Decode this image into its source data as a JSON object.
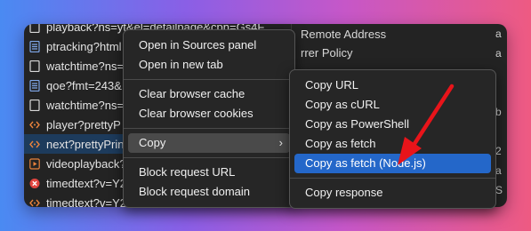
{
  "network_requests": [
    {
      "name": "playback?ns=yt&el=detailpage&cpn=Gs4F...",
      "icon": "document-icon",
      "type": "doc",
      "selected": false
    },
    {
      "name": "ptracking?html",
      "icon": "document-icon",
      "type": "doc-blue",
      "selected": false
    },
    {
      "name": "watchtime?ns=",
      "icon": "document-icon",
      "type": "doc",
      "selected": false
    },
    {
      "name": "qoe?fmt=243&",
      "icon": "document-icon",
      "type": "doc-blue",
      "selected": false
    },
    {
      "name": "watchtime?ns=",
      "icon": "document-icon",
      "type": "doc",
      "selected": false
    },
    {
      "name": "player?prettyP",
      "icon": "code-icon",
      "type": "code",
      "selected": false
    },
    {
      "name": "next?prettyPrin",
      "icon": "code-icon",
      "type": "code",
      "selected": true
    },
    {
      "name": "videoplayback?",
      "icon": "media-icon",
      "type": "media",
      "selected": false
    },
    {
      "name": "timedtext?v=Y2",
      "icon": "error-icon",
      "type": "error",
      "selected": false
    },
    {
      "name": "timedtext?v=Y2",
      "icon": "code-icon",
      "type": "code",
      "selected": false
    }
  ],
  "headers_panel": {
    "remote_address_label": "Remote Address",
    "referrer_policy_label": "rrer Policy",
    "edge_chars": [
      "a",
      "a",
      "",
      "",
      "b",
      "",
      "2",
      "a",
      "S",
      ""
    ]
  },
  "context_menu": {
    "items": [
      {
        "label": "Open in Sources panel",
        "group": 1
      },
      {
        "label": "Open in new tab",
        "group": 1
      },
      {
        "label": "Clear browser cache",
        "group": 2
      },
      {
        "label": "Clear browser cookies",
        "group": 2
      },
      {
        "label": "Copy",
        "group": 3,
        "has_submenu": true,
        "submenu_icon": "chevron-right-icon"
      },
      {
        "label": "Block request URL",
        "group": 4
      },
      {
        "label": "Block request domain",
        "group": 4
      }
    ]
  },
  "copy_submenu": {
    "items": [
      {
        "label": "Copy URL",
        "group": 1
      },
      {
        "label": "Copy as cURL",
        "group": 1
      },
      {
        "label": "Copy as PowerShell",
        "group": 1
      },
      {
        "label": "Copy as fetch",
        "group": 1
      },
      {
        "label": "Copy as fetch (Node.js)",
        "group": 1,
        "highlighted": true
      },
      {
        "label": "Copy response",
        "group": 2
      }
    ]
  },
  "annotation": {
    "arrow_color": "#e8141a",
    "arrow_icon": "red-arrow-icon"
  },
  "colors": {
    "selection_highlight": "#2467c9",
    "selected_row": "#1d3b5c",
    "doc_icon_blue": "#7fa6e8",
    "code_icon_orange": "#e8823c",
    "error_icon_red": "#e0453f"
  }
}
